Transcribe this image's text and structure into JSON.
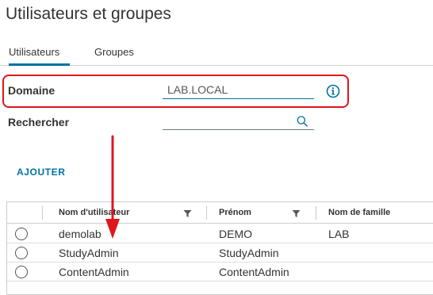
{
  "page": {
    "title": "Utilisateurs et groupes"
  },
  "tabs": [
    {
      "label": "Utilisateurs",
      "active": true
    },
    {
      "label": "Groupes",
      "active": false
    }
  ],
  "domain": {
    "label": "Domaine",
    "value": "LAB.LOCAL",
    "info_icon": "info-circle-icon"
  },
  "search": {
    "label": "Rechercher",
    "value": "",
    "icon": "search-icon"
  },
  "actions": {
    "add_label": "AJOUTER"
  },
  "table": {
    "columns": [
      {
        "label": "Nom d'utilisateur",
        "filterable": true
      },
      {
        "label": "Prénom",
        "filterable": true
      },
      {
        "label": "Nom de famille",
        "filterable": false
      }
    ],
    "rows": [
      {
        "username": "demolab",
        "first_name": "DEMO",
        "last_name": "LAB"
      },
      {
        "username": "StudyAdmin",
        "first_name": "StudyAdmin",
        "last_name": ""
      },
      {
        "username": "ContentAdmin",
        "first_name": "ContentAdmin",
        "last_name": ""
      }
    ]
  },
  "colors": {
    "accent": "#0072a3",
    "annotation": "#e0161b",
    "text": "#333333",
    "border": "#cccccc"
  }
}
